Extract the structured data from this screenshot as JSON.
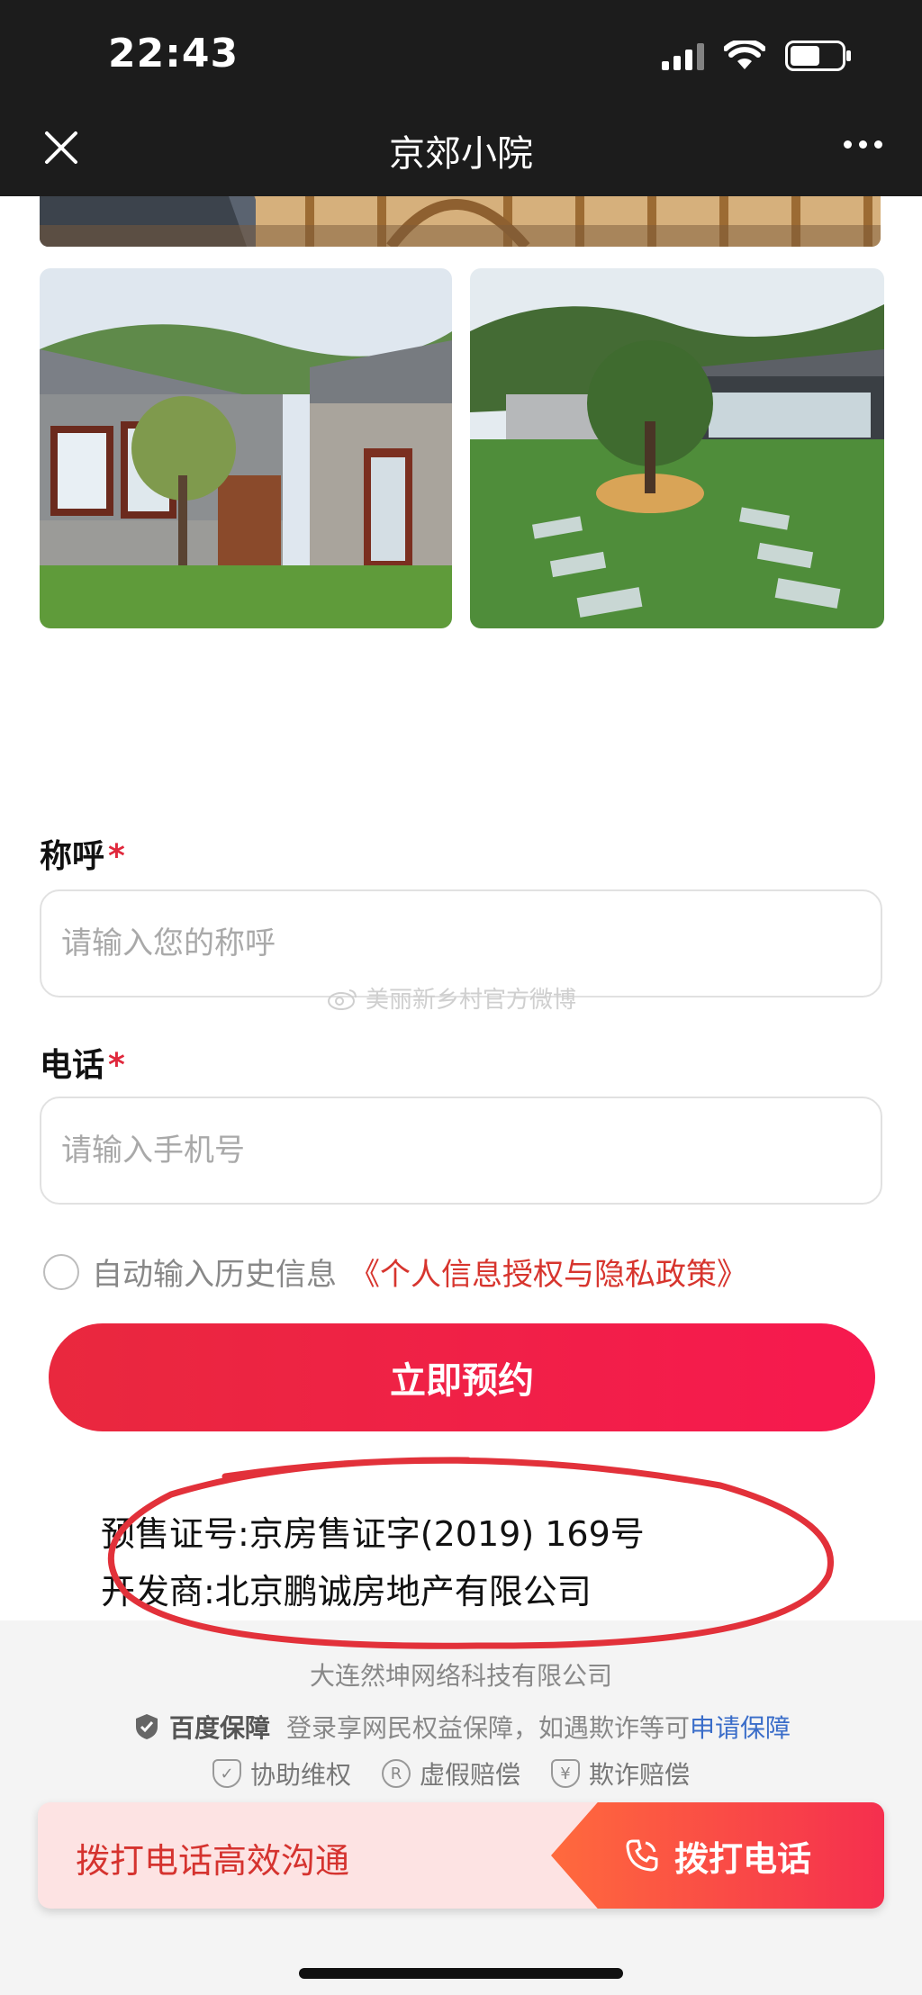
{
  "status_bar": {
    "time": "22:43"
  },
  "nav": {
    "title": "京郊小院"
  },
  "watermark": {
    "text": "美丽新乡村官方微博"
  },
  "form": {
    "name_label": "称呼",
    "name_placeholder": "请输入您的称呼",
    "phone_label": "电话",
    "phone_placeholder": "请输入手机号",
    "required_mark": "*",
    "auto_fill_text": "自动输入历史信息",
    "policy_link": "《个人信息授权与隐私政策》",
    "submit_label": "立即预约"
  },
  "disclosure": {
    "presale_license": "预售证号:京房售证字(2019) 169号",
    "developer": "开发商:北京鹏诚房地产有限公司"
  },
  "footer": {
    "company": "大连然坤网络科技有限公司",
    "guarantee_brand": "百度保障",
    "guarantee_text": "登录享网民权益保障，如遇欺诈等可",
    "guarantee_link": "申请保障",
    "badges": [
      {
        "label": "协助维权",
        "icon": "shield-check-icon"
      },
      {
        "label": "虚假赔偿",
        "icon": "registered-icon"
      },
      {
        "label": "欺诈赔偿",
        "icon": "yen-shield-icon"
      }
    ]
  },
  "call_bar": {
    "text": "拨打电话高效沟通",
    "button_label": "拨打电话"
  },
  "colors": {
    "accent": "#e9283e",
    "topbar": "#1c1c1c",
    "link": "#3a6dc9"
  }
}
